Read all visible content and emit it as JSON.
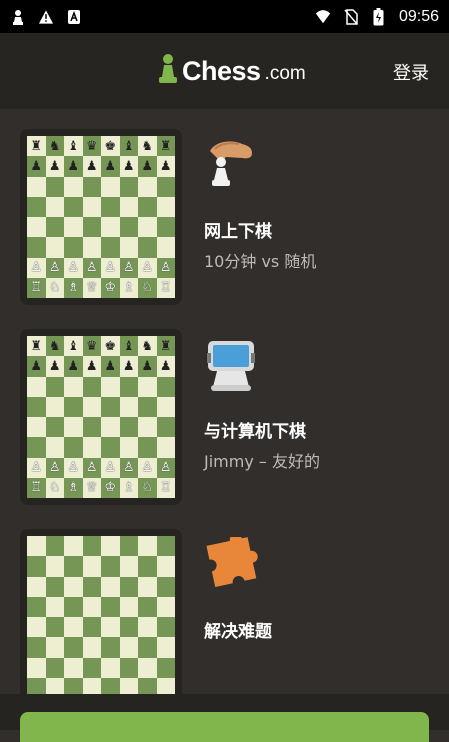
{
  "status": {
    "time": "09:56"
  },
  "header": {
    "logo_text": "Chess",
    "logo_suffix": ".com",
    "login_label": "登录"
  },
  "cards": [
    {
      "title": "网上下棋",
      "subtitle": "10分钟 vs 随机",
      "icon": "hand-pawn-icon"
    },
    {
      "title": "与计算机下棋",
      "subtitle": "Jimmy – 友好的",
      "icon": "computer-icon"
    },
    {
      "title": "解决难题",
      "subtitle": "",
      "icon": "puzzle-icon"
    }
  ],
  "colors": {
    "background": "#312e2b",
    "header": "#272522",
    "board_light": "#eeeed2",
    "board_dark": "#769656",
    "accent": "#81b64c"
  }
}
